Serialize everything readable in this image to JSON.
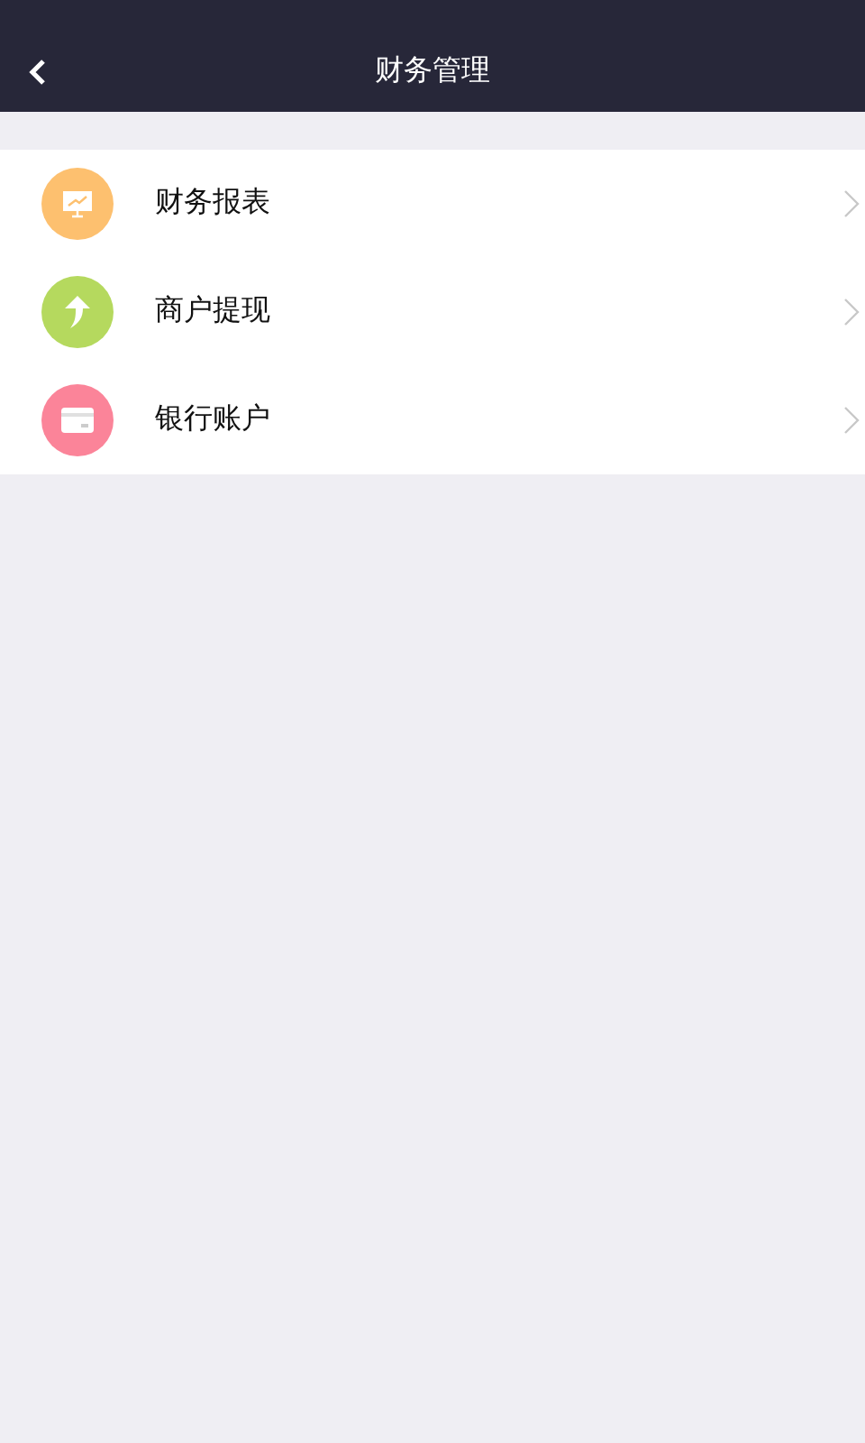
{
  "header": {
    "title": "财务管理"
  },
  "menu": [
    {
      "label": "财务报表",
      "kind": "report",
      "color": "#fdc06f"
    },
    {
      "label": "商户提现",
      "kind": "withdraw",
      "color": "#b5d95e"
    },
    {
      "label": "银行账户",
      "kind": "card",
      "color": "#fb8499"
    }
  ]
}
